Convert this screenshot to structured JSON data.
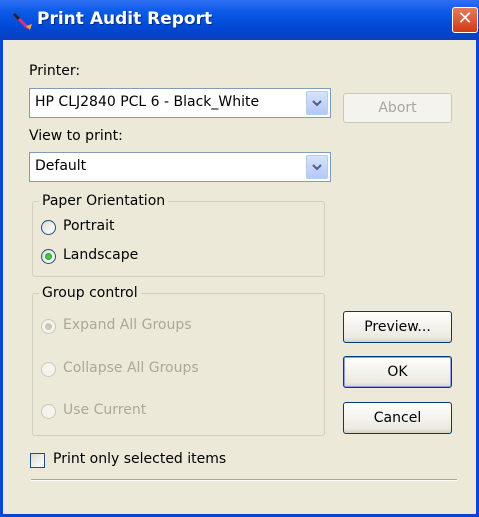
{
  "window": {
    "title": "Print Audit Report",
    "close_glyph": "✕"
  },
  "printer": {
    "label": "Printer:",
    "selected": "HP CLJ2840 PCL 6 - Black_White"
  },
  "abort_label": "Abort",
  "view": {
    "label": "View to print:",
    "selected": "Default"
  },
  "orientation": {
    "legend": "Paper Orientation",
    "options": [
      {
        "label": "Portrait",
        "checked": false
      },
      {
        "label": "Landscape",
        "checked": true
      }
    ]
  },
  "group_control": {
    "legend": "Group control",
    "enabled": false,
    "options": [
      {
        "label": "Expand All Groups",
        "checked": true
      },
      {
        "label": "Collapse All Groups",
        "checked": false
      },
      {
        "label": "Use Current",
        "checked": false
      }
    ]
  },
  "buttons": {
    "preview": "Preview...",
    "ok": "OK",
    "cancel": "Cancel"
  },
  "selected_only": {
    "label": "Print only selected items",
    "checked": false
  },
  "colors": {
    "title_bar": "#0a5ae8",
    "dialog_bg": "#ece9d8",
    "close_button": "#cf3a14",
    "radio_dot": "#1d9a1d"
  }
}
